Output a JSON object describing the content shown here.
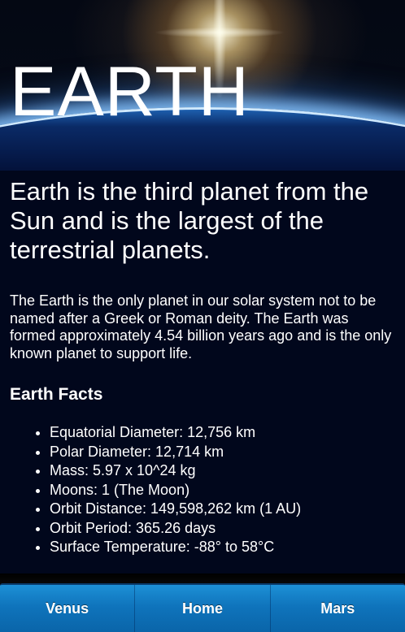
{
  "hero": {
    "title": "EARTH"
  },
  "main": {
    "headline": "Earth is the third planet from the Sun and is the largest of the terrestrial planets.",
    "intro": "The Earth is the only planet in our solar system not to be named after a Greek or Roman deity. The Earth was formed approximately 4.54 billion years ago and is the only known planet to support life.",
    "facts_heading": "Earth Facts",
    "facts": [
      "Equatorial Diameter: 12,756 km",
      "Polar Diameter: 12,714 km",
      "Mass: 5.97 x 10^24 kg",
      "Moons: 1 (The Moon)",
      "Orbit Distance: 149,598,262 km (1 AU)",
      "Orbit Period: 365.26 days",
      "Surface Temperature: -88° to 58°C"
    ]
  },
  "nav": {
    "items": [
      "Venus",
      "Home",
      "Mars"
    ]
  },
  "colors": {
    "background": "#01071c",
    "nav_bar": "#0f74bc",
    "text": "#ffffff"
  }
}
